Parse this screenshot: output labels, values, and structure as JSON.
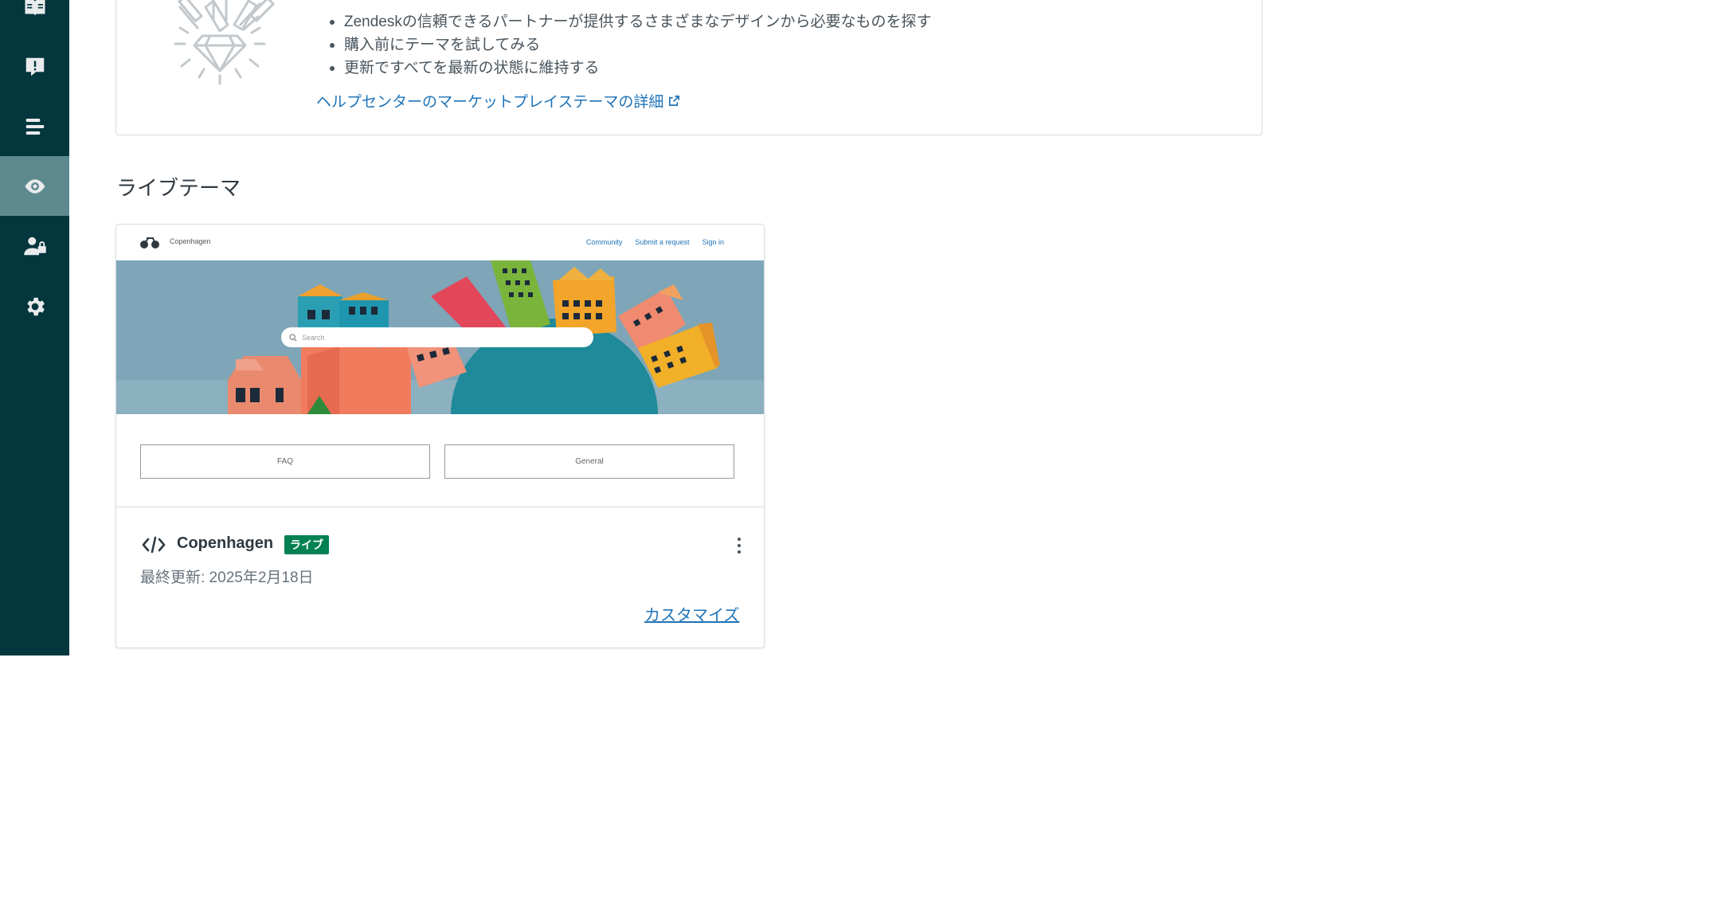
{
  "sidebar": {
    "items": [
      {
        "icon": "book-icon",
        "active": false
      },
      {
        "icon": "alert-comment-icon",
        "active": false
      },
      {
        "icon": "list-icon",
        "active": false
      },
      {
        "icon": "eye-icon",
        "active": true
      },
      {
        "icon": "user-lock-icon",
        "active": false
      },
      {
        "icon": "gear-icon",
        "active": false
      }
    ]
  },
  "marketplace": {
    "bullets": [
      "Zendeskの信頼できるパートナーが提供するさまざまなデザインから必要なものを探す",
      "購入前にテーマを試してみる",
      "更新ですべてを最新の状態に維持する"
    ],
    "link_text": "ヘルプセンターのマーケットプレイステーマの詳細"
  },
  "live_section": {
    "title": "ライブテーマ"
  },
  "theme": {
    "preview": {
      "brand": "Copenhagen",
      "nav": [
        "Community",
        "Submit a request",
        "Sign in"
      ],
      "search_placeholder": "Search",
      "categories": [
        "FAQ",
        "General"
      ]
    },
    "name": "Copenhagen",
    "badge": "ライブ",
    "updated": "最終更新: 2025年2月18日",
    "customize_label": "カスタマイズ"
  },
  "colors": {
    "sidebar_bg": "#03363d",
    "sidebar_active": "#5d8a8e",
    "link": "#1f73b7",
    "live_badge": "#038153"
  }
}
